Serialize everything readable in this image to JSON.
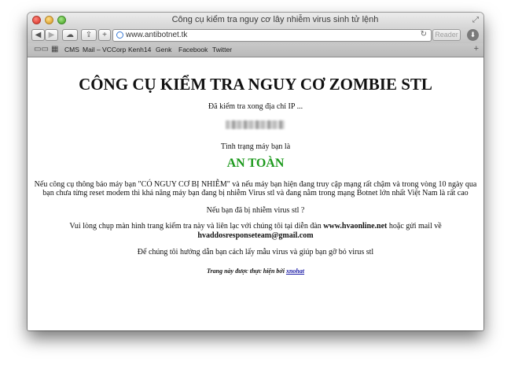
{
  "window": {
    "title": "Công cụ kiểm tra nguy cơ lây nhiễm virus sinh tử lệnh"
  },
  "toolbar": {
    "url": "www.antibotnet.tk",
    "reader_label": "Reader",
    "back_icon": "chevron-left-icon",
    "forward_icon": "chevron-right-icon",
    "icloud_icon": "cloud-icon",
    "share_icon": "share-icon",
    "new_tab_icon": "plus-icon"
  },
  "bookmarks": {
    "items": [
      {
        "label": "CMS"
      },
      {
        "label": "Mail – VCCorp"
      },
      {
        "label": "Kenh14"
      },
      {
        "label": "Genk"
      },
      {
        "label": "Facebook"
      },
      {
        "label": "Twitter"
      }
    ]
  },
  "page": {
    "title": "CÔNG CỤ KIỂM TRA NGUY CƠ ZOMBIE STL",
    "check_text": "Đã kiểm tra xong địa chỉ IP ...",
    "status_label": "Tình trạng máy bạn là",
    "status_value": "AN TOÀN",
    "status_color": "#1e9a1e",
    "warning_line1": "Nếu công cụ thông báo máy bạn \"CÓ NGUY CƠ BỊ NHIỄM\" và nếu máy bạn hiện đang truy cập mạng rất chậm và trong vòng 10 ngày qua",
    "warning_line2": "bạn chưa từng reset modem thì khả năng máy bạn đang bị nhiễm Virus stl và đang nằm trong mạng Botnet lớn nhất Việt Nam là rất cao",
    "infected_question": "Nếu bạn đã bị nhiễm virus stl ?",
    "contact_prefix": "Vui lòng chụp màn hình trang kiểm tra này và liên lạc với chúng tôi tại diễn đàn ",
    "contact_forum": "www.hvaonline.net",
    "contact_middle": " hoặc gửi mail về",
    "contact_email": "hvaddosresponseteam@gmail.com",
    "guide_text": "Để chúng tôi hướng dẫn bạn cách lấy mẫu virus và giúp bạn gỡ bỏ virus stl",
    "credit_prefix": "Trang này được thực hiện bởi ",
    "credit_link": "xnohat"
  }
}
